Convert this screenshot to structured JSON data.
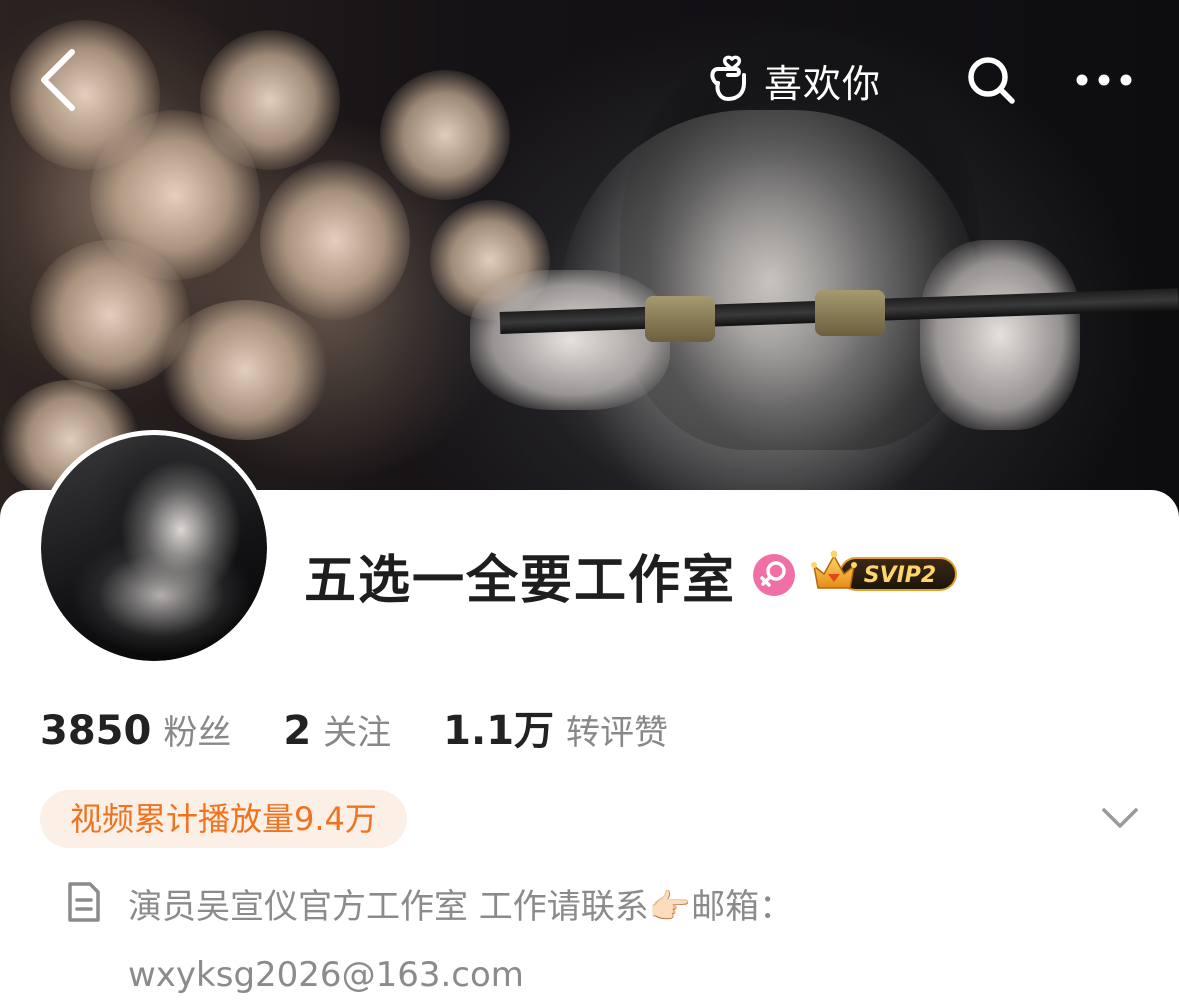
{
  "nav": {
    "like_label": "喜欢你"
  },
  "profile": {
    "name": "五选一全要工作室",
    "gender": "female",
    "vip_badge": "SVIP2"
  },
  "stats": [
    {
      "value": "3850",
      "label": "粉丝"
    },
    {
      "value": "2",
      "label": "关注"
    },
    {
      "value": "1.1万",
      "label": "转评赞"
    }
  ],
  "video_stat": "视频累计播放量9.4万",
  "bio": "演员吴宣仪官方工作室 工作请联系👉🏻邮箱：wxyksg2026@163.com",
  "colors": {
    "accent_orange": "#f0731f",
    "pill_bg": "#fbefe6",
    "gender_pink": "#f06fa4",
    "text_dark": "#1e1e1e",
    "text_gray": "#888888"
  }
}
